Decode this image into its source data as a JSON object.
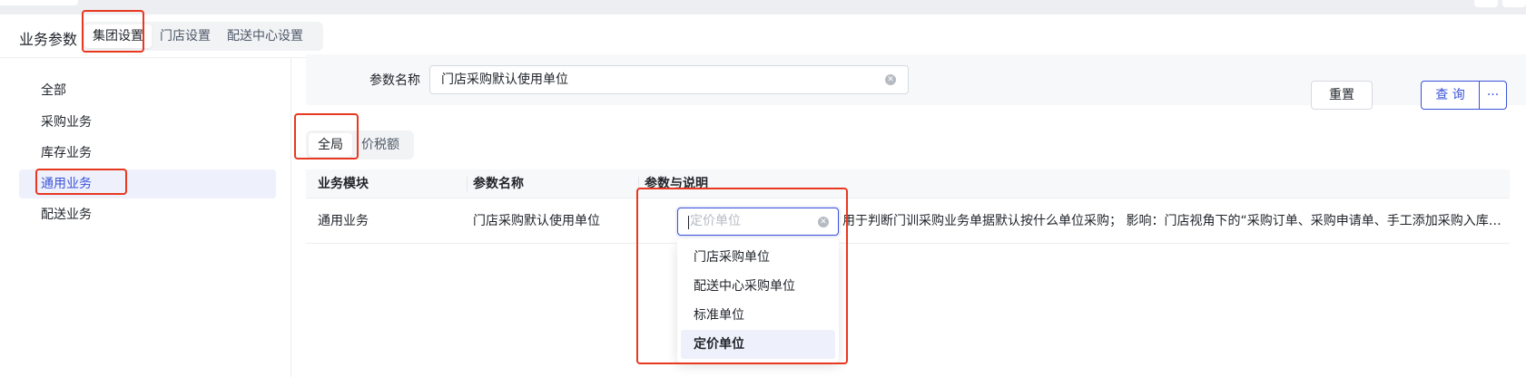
{
  "header": {
    "title": "业务参数",
    "segments": [
      {
        "label": "集团设置",
        "active": true
      },
      {
        "label": "门店设置",
        "active": false
      },
      {
        "label": "配送中心设置",
        "active": false
      }
    ]
  },
  "sidebar": {
    "items": [
      {
        "label": "全部",
        "active": false
      },
      {
        "label": "采购业务",
        "active": false
      },
      {
        "label": "库存业务",
        "active": false
      },
      {
        "label": "通用业务",
        "active": true
      },
      {
        "label": "配送业务",
        "active": false
      }
    ]
  },
  "filter": {
    "label": "参数名称",
    "value": "门店采购默认使用单位",
    "reset_label": "重置",
    "query_label": "查 询",
    "more_label": "···"
  },
  "tabs": [
    {
      "label": "全局",
      "active": true
    },
    {
      "label": "价税额",
      "active": false
    }
  ],
  "table": {
    "headers": [
      "业务模块",
      "参数名称",
      "参数与说明"
    ],
    "rows": [
      {
        "module": "通用业务",
        "name": "门店采购默认使用单位",
        "select_placeholder": "定价单位",
        "description": "用于判断门训采购业务单据默认按什么单位采购； 影响：门店视角下的“采购订单、采购申请单、手工添加采购入库单”"
      }
    ]
  },
  "dropdown": {
    "options": [
      {
        "label": "门店采购单位",
        "selected": false
      },
      {
        "label": "配送中心采购单位",
        "selected": false
      },
      {
        "label": "标准单位",
        "selected": false
      },
      {
        "label": "定价单位",
        "selected": true
      }
    ]
  },
  "colors": {
    "accent": "#3a52d9",
    "highlight": "#e8381f",
    "selected_bg": "#eef0fb"
  }
}
